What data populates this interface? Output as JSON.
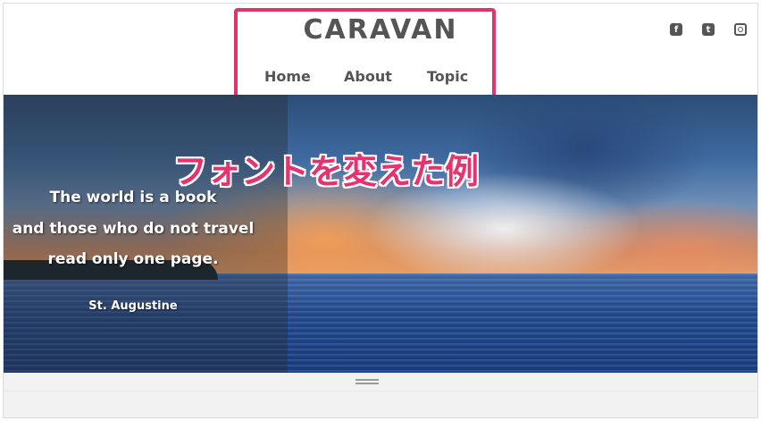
{
  "header": {
    "brand": "CARAVAN",
    "nav": {
      "home": "Home",
      "about": "About",
      "topic": "Topic"
    },
    "social": {
      "facebook": "f",
      "twitter": "t",
      "instagram": ""
    }
  },
  "hero": {
    "caption": "フォントを変えた例",
    "quote": {
      "line1": "The world is a book",
      "line2": "and those who do not travel",
      "line3": "read only one page.",
      "author": "St. Augustine"
    }
  },
  "colors": {
    "accent": "#e0356b",
    "text": "#555555",
    "caption": "#e5336f"
  },
  "icons": {
    "facebook": "facebook-icon",
    "twitter": "twitter-icon",
    "instagram": "instagram-icon",
    "handle": "drag-handle-icon"
  }
}
